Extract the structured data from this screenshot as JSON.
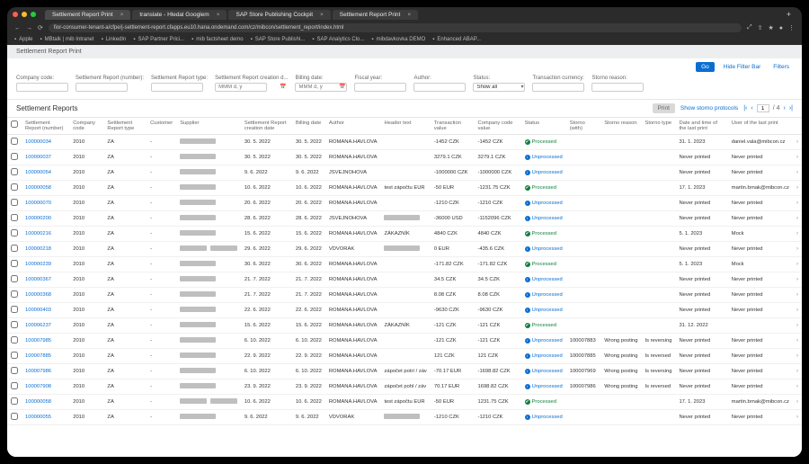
{
  "browser": {
    "tabs": [
      {
        "label": "Settlement Report Print",
        "active": true
      },
      {
        "label": "translate - Hledal Googlem",
        "active": false
      },
      {
        "label": "SAP Store Publishing Cockpit",
        "active": false
      },
      {
        "label": "Settlement Report Print",
        "active": false
      }
    ],
    "url": "fior-consumer-tenant-a/cfpe/j-settlement-report.cfapps.eu10.hana.ondemand.com/cz/mibcon/settlement_report/index.html",
    "bookmarks": [
      "Apple",
      "MBtalk | mib Intranet",
      "LinkedIn",
      "SAP Partner Prici...",
      "mib factsheet demo",
      "SAP Store Publishi...",
      "SAP Analytics Clo...",
      "mibdavkovka DEMO",
      "Enhanced ABAP..."
    ]
  },
  "app": {
    "title": "Settlement Report Print",
    "filter": {
      "go": "Go",
      "hide_filter": "Hide Filter Bar",
      "filters": "Filters",
      "fields": [
        {
          "label": "Company code:",
          "placeholder": ""
        },
        {
          "label": "Settlement Report (number):",
          "placeholder": ""
        },
        {
          "label": "Settlement Report type:",
          "placeholder": ""
        },
        {
          "label": "Settlement Report creation d...",
          "placeholder": "MMM d, y",
          "date": true
        },
        {
          "label": "Billing date:",
          "placeholder": "MMM d, y",
          "date": true
        },
        {
          "label": "Fiscal year:",
          "placeholder": ""
        },
        {
          "label": "Author:",
          "placeholder": ""
        },
        {
          "label": "Status:",
          "value": "Show all",
          "select": true
        },
        {
          "label": "Transaction currency:",
          "placeholder": ""
        },
        {
          "label": "Storno reason:",
          "placeholder": ""
        }
      ]
    },
    "section": {
      "title": "Settlement Reports",
      "print_btn": "Print",
      "show_storno": "Show storno protocols",
      "page_current": "1",
      "page_total": "/ 4"
    },
    "columns": [
      "",
      "Settlement Report (number)",
      "Company code",
      "Settlement Report type",
      "Customer",
      "Supplier",
      "Settlement Report creation date",
      "Billing date",
      "Author",
      "Header text",
      "Transaction value",
      "Company code value",
      "Status",
      "Storno (with)",
      "Storno reason",
      "Storno type",
      "Date and time of the last print",
      "User of the last print"
    ],
    "rows": [
      {
        "num": "100000034",
        "code": "2010",
        "type": "ZA",
        "cust": "-",
        "sup": "blur",
        "cdate": "30. 5. 2022",
        "bdate": "30. 5. 2022",
        "author": "ROMANA.HAVLOVA",
        "htext": "",
        "tval": "-1452 CZK",
        "cval": "-1452 CZK",
        "status": "Processed",
        "storno": "",
        "sreason": "",
        "stype": "",
        "ptime": "31. 1. 2023",
        "puser": "daniel.vala@mibcon.cz"
      },
      {
        "num": "100000037",
        "code": "2010",
        "type": "ZA",
        "cust": "-",
        "sup": "blur",
        "cdate": "30. 5. 2022",
        "bdate": "30. 5. 2022",
        "author": "ROMANA.HAVLOVA",
        "htext": "",
        "tval": "3279.1 CZK",
        "cval": "3279.1 CZK",
        "status": "Unprocessed",
        "storno": "",
        "sreason": "",
        "stype": "",
        "ptime": "Never printed",
        "puser": "Never printed"
      },
      {
        "num": "100000054",
        "code": "2010",
        "type": "ZA",
        "cust": "-",
        "sup": "blur",
        "cdate": "9. 6. 2022",
        "bdate": "9. 6. 2022",
        "author": "JSVEJNOHOVA",
        "htext": "",
        "tval": "-1000000 CZK",
        "cval": "-1000000 CZK",
        "status": "Unprocessed",
        "storno": "",
        "sreason": "",
        "stype": "",
        "ptime": "Never printed",
        "puser": "Never printed"
      },
      {
        "num": "100000058",
        "code": "2010",
        "type": "ZA",
        "cust": "-",
        "sup": "blur",
        "cdate": "10. 6. 2022",
        "bdate": "10. 6. 2022",
        "author": "ROMANA.HAVLOVA",
        "htext": "test zápočtu EUR",
        "tval": "-50 EUR",
        "cval": "-1231.75 CZK",
        "status": "Processed",
        "storno": "",
        "sreason": "",
        "stype": "",
        "ptime": "17. 1. 2023",
        "puser": "martin.brnak@mibcon.cz"
      },
      {
        "num": "100000070",
        "code": "2010",
        "type": "ZA",
        "cust": "-",
        "sup": "blur",
        "cdate": "20. 6. 2022",
        "bdate": "20. 6. 2022",
        "author": "ROMANA.HAVLOVA",
        "htext": "",
        "tval": "-1210 CZK",
        "cval": "-1210 CZK",
        "status": "Unprocessed",
        "storno": "",
        "sreason": "",
        "stype": "",
        "ptime": "Never printed",
        "puser": "Never printed"
      },
      {
        "num": "100000200",
        "code": "2010",
        "type": "ZA",
        "cust": "-",
        "sup": "blur",
        "cdate": "28. 6. 2022",
        "bdate": "28. 6. 2022",
        "author": "JSVEJNOHOVA",
        "htext": "blur",
        "tval": "-36000 USD",
        "cval": "-1152096 CZK",
        "status": "Unprocessed",
        "storno": "",
        "sreason": "",
        "stype": "",
        "ptime": "Never printed",
        "puser": "Never printed"
      },
      {
        "num": "100000216",
        "code": "2010",
        "type": "ZA",
        "cust": "-",
        "sup": "blur",
        "cdate": "15. 6. 2022",
        "bdate": "15. 6. 2022",
        "author": "ROMANA.HAVLOVA",
        "htext": "ZÁKAZNÍK",
        "tval": "4840 CZK",
        "cval": "4840 CZK",
        "status": "Processed",
        "storno": "",
        "sreason": "",
        "stype": "",
        "ptime": "5. 1. 2023",
        "puser": "Mock"
      },
      {
        "num": "100000218",
        "code": "2010",
        "type": "ZA",
        "cust": "-",
        "sup": "blur2",
        "cdate": "29. 6. 2022",
        "bdate": "29. 6. 2022",
        "author": "VDVORAK",
        "htext": "blur",
        "tval": "0 EUR",
        "cval": "-435.6 CZK",
        "status": "Unprocessed",
        "storno": "",
        "sreason": "",
        "stype": "",
        "ptime": "Never printed",
        "puser": "Never printed"
      },
      {
        "num": "100000239",
        "code": "2010",
        "type": "ZA",
        "cust": "-",
        "sup": "blur",
        "cdate": "30. 6. 2022",
        "bdate": "30. 6. 2022",
        "author": "ROMANA.HAVLOVA",
        "htext": "",
        "tval": "-171.82 CZK",
        "cval": "-171.82 CZK",
        "status": "Processed",
        "storno": "",
        "sreason": "",
        "stype": "",
        "ptime": "5. 1. 2023",
        "puser": "Mock"
      },
      {
        "num": "100000367",
        "code": "2010",
        "type": "ZA",
        "cust": "-",
        "sup": "blur",
        "cdate": "21. 7. 2022",
        "bdate": "21. 7. 2022",
        "author": "ROMANA.HAVLOVA",
        "htext": "",
        "tval": "34.5 CZK",
        "cval": "34.5 CZK",
        "status": "Unprocessed",
        "storno": "",
        "sreason": "",
        "stype": "",
        "ptime": "Never printed",
        "puser": "Never printed"
      },
      {
        "num": "100000368",
        "code": "2010",
        "type": "ZA",
        "cust": "-",
        "sup": "blur",
        "cdate": "21. 7. 2022",
        "bdate": "21. 7. 2022",
        "author": "ROMANA.HAVLOVA",
        "htext": "",
        "tval": "8.08 CZK",
        "cval": "8.08 CZK",
        "status": "Unprocessed",
        "storno": "",
        "sreason": "",
        "stype": "",
        "ptime": "Never printed",
        "puser": "Never printed"
      },
      {
        "num": "100000403",
        "code": "2010",
        "type": "ZA",
        "cust": "-",
        "sup": "blur",
        "cdate": "22. 6. 2022",
        "bdate": "22. 6. 2022",
        "author": "ROMANA.HAVLOVA",
        "htext": "",
        "tval": "-9630 CZK",
        "cval": "-9630 CZK",
        "status": "Unprocessed",
        "storno": "",
        "sreason": "",
        "stype": "",
        "ptime": "Never printed",
        "puser": "Never printed"
      },
      {
        "num": "100006237",
        "code": "2010",
        "type": "ZA",
        "cust": "-",
        "sup": "blur",
        "cdate": "15. 6. 2022",
        "bdate": "15. 6. 2022",
        "author": "ROMANA.HAVLOVA",
        "htext": "ZÁKAZNÍK",
        "tval": "-121 CZK",
        "cval": "-121 CZK",
        "status": "Processed",
        "storno": "",
        "sreason": "",
        "stype": "",
        "ptime": "31. 12. 2022",
        "puser": ""
      },
      {
        "num": "100007985",
        "code": "2010",
        "type": "ZA",
        "cust": "-",
        "sup": "blur",
        "cdate": "6. 10. 2022",
        "bdate": "6. 10. 2022",
        "author": "ROMANA.HAVLOVA",
        "htext": "",
        "tval": "-121 CZK",
        "cval": "-121 CZK",
        "status": "Unprocessed",
        "storno": "100007883",
        "sreason": "Wrong posting",
        "stype": "Is reversing",
        "ptime": "Never printed",
        "puser": "Never printed"
      },
      {
        "num": "100007885",
        "code": "2010",
        "type": "ZA",
        "cust": "-",
        "sup": "blur",
        "cdate": "22. 9. 2022",
        "bdate": "22. 9. 2022",
        "author": "ROMANA.HAVLOVA",
        "htext": "",
        "tval": "121 CZK",
        "cval": "121 CZK",
        "status": "Unprocessed",
        "storno": "100007885",
        "sreason": "Wrong posting",
        "stype": "Is reversed",
        "ptime": "Never printed",
        "puser": "Never printed"
      },
      {
        "num": "100007986",
        "code": "2010",
        "type": "ZA",
        "cust": "-",
        "sup": "blur",
        "cdate": "6. 10. 2022",
        "bdate": "6. 10. 2022",
        "author": "ROMANA.HAVLOVA",
        "htext": "zápočet potrí / záv",
        "tval": "-70.17 EUR",
        "cval": "-1698.82 CZK",
        "status": "Unprocessed",
        "storno": "100007969",
        "sreason": "Wrong posting",
        "stype": "Is reversing",
        "ptime": "Never printed",
        "puser": "Never printed"
      },
      {
        "num": "100007908",
        "code": "2010",
        "type": "ZA",
        "cust": "-",
        "sup": "blur",
        "cdate": "23. 9. 2022",
        "bdate": "23. 9. 2022",
        "author": "ROMANA.HAVLOVA",
        "htext": "zápočet pohl / záv",
        "tval": "70.17 EUR",
        "cval": "1698.82 CZK",
        "status": "Unprocessed",
        "storno": "100007986",
        "sreason": "Wrong posting",
        "stype": "Is reversed",
        "ptime": "Never printed",
        "puser": "Never printed"
      },
      {
        "num": "100000058",
        "code": "2010",
        "type": "ZA",
        "cust": "-",
        "sup": "blur2",
        "cdate": "10. 6. 2022",
        "bdate": "10. 6. 2022",
        "author": "ROMANA.HAVLOVA",
        "htext": "test zápočtu EUR",
        "tval": "-50 EUR",
        "cval": "1231.75 CZK",
        "status": "Processed",
        "storno": "",
        "sreason": "",
        "stype": "",
        "ptime": "17. 1. 2023",
        "puser": "martin.brnak@mibcon.cz"
      },
      {
        "num": "100000055",
        "code": "2010",
        "type": "ZA",
        "cust": "-",
        "sup": "blur",
        "cdate": "9. 6. 2022",
        "bdate": "9. 6. 2022",
        "author": "VDVORAK",
        "htext": "blur",
        "tval": "-1210 CZK",
        "cval": "-1210 CZK",
        "status": "Unprocessed",
        "storno": "",
        "sreason": "",
        "stype": "",
        "ptime": "Never printed",
        "puser": "Never printed"
      }
    ]
  }
}
